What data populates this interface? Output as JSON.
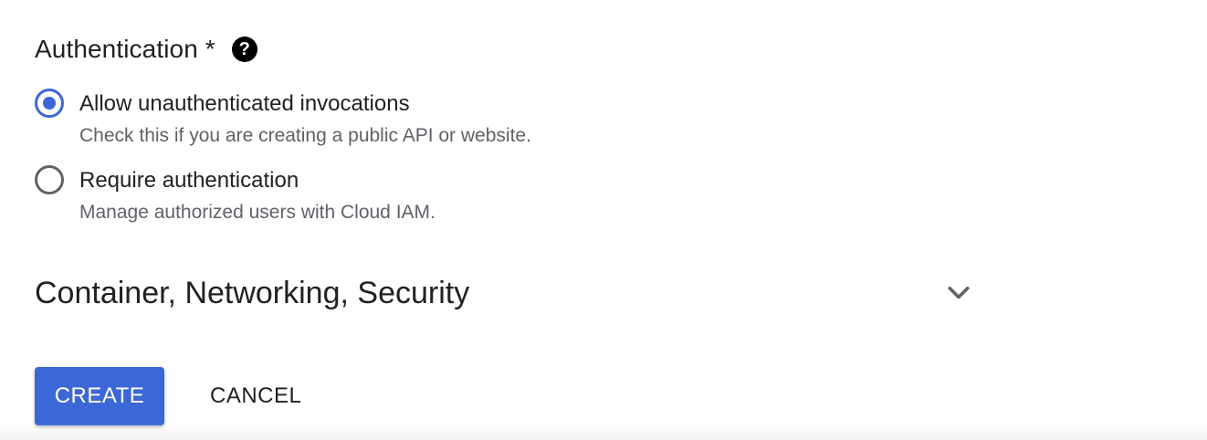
{
  "authentication": {
    "title": "Authentication *",
    "help_icon": "question-circle-icon",
    "help_glyph": "?",
    "options": [
      {
        "label": "Allow unauthenticated invocations",
        "description": "Check this if you are creating a public API or website.",
        "selected": true
      },
      {
        "label": "Require authentication",
        "description": "Manage authorized users with Cloud IAM.",
        "selected": false
      }
    ]
  },
  "advanced_section": {
    "title": "Container, Networking, Security",
    "expand_icon": "chevron-down-icon",
    "expanded": false
  },
  "actions": {
    "create_label": "CREATE",
    "cancel_label": "CANCEL"
  },
  "colors": {
    "accent": "#3c67d6",
    "text_primary": "#202124",
    "text_secondary": "#5f6368",
    "radio_unselected": "#5f6368"
  }
}
